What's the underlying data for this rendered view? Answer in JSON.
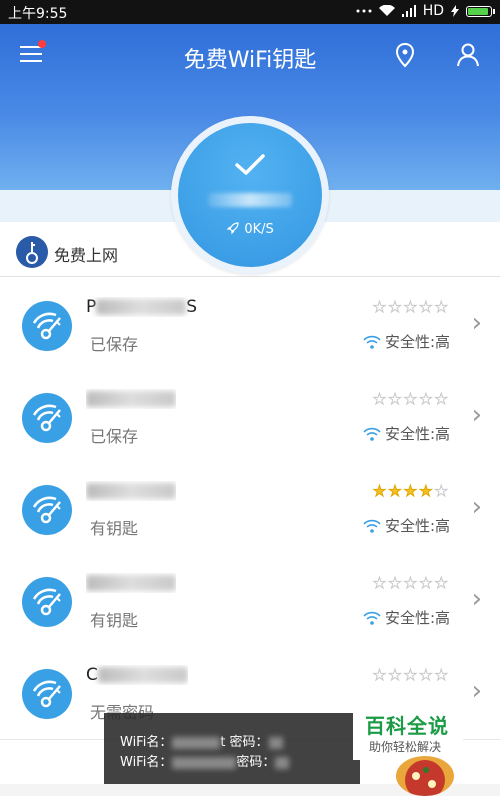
{
  "status_bar": {
    "time": "上午9:55",
    "network": "HD"
  },
  "header": {
    "title": "免费WiFi钥匙",
    "menu_icon": "menu-icon",
    "location_icon": "location-pin-icon",
    "profile_icon": "person-icon"
  },
  "connection": {
    "speed": "0K/S",
    "check_icon": "check-icon"
  },
  "free_internet": {
    "label": "免费上网"
  },
  "wifi_list": [
    {
      "name_visible": "P",
      "name_suffix": "S",
      "status": "已保存",
      "stars": 0,
      "security": "安全性:高"
    },
    {
      "name_visible": "",
      "name_suffix": "",
      "status": "已保存",
      "stars": 0,
      "security": "安全性:高"
    },
    {
      "name_visible": "",
      "name_suffix": "",
      "status": "有钥匙",
      "stars": 4,
      "security": "安全性:高"
    },
    {
      "name_visible": "",
      "name_suffix": "",
      "status": "有钥匙",
      "stars": 0,
      "security": "安全性:高"
    },
    {
      "name_visible": "C",
      "name_suffix": "",
      "status": "无需密码",
      "stars": 0,
      "security": ""
    }
  ],
  "toast": {
    "line1_prefix": "WiFi名：",
    "line1_mid": "t 密码：",
    "line2_prefix": "WiFi名：",
    "line2_mid": "密码："
  },
  "watermark": {
    "title": "百科全说",
    "subtitle": "助你轻松解决"
  },
  "colors": {
    "header_top": "#2f6fd8",
    "accent_blue": "#3aa0e6",
    "star_on": "#f5c023",
    "baike_green": "#1b9b45"
  }
}
